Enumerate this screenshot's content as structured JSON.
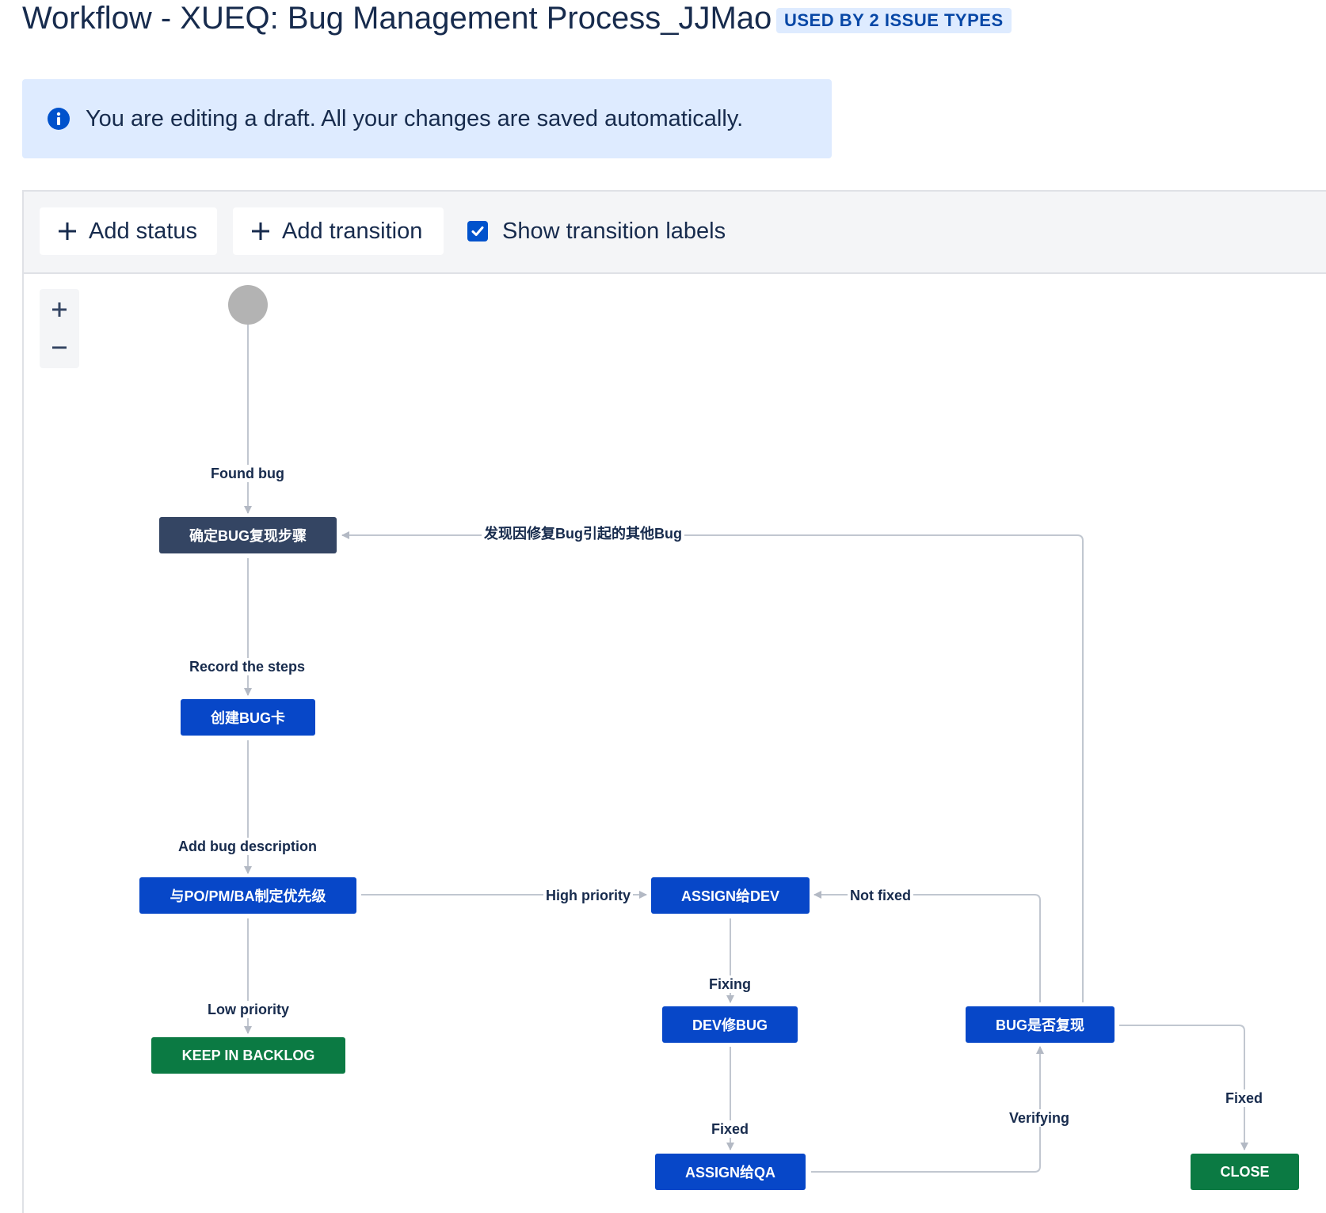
{
  "page": {
    "title": "Workflow - XUEQ: Bug Management Process_JJMao",
    "usage_badge": "USED BY 2 ISSUE TYPES"
  },
  "banner": {
    "icon": "info-icon",
    "message": "You are editing a draft. All your changes are saved automatically."
  },
  "toolbar": {
    "add_status_label": "Add status",
    "add_transition_label": "Add transition",
    "show_labels_label": "Show transition labels",
    "show_labels_checked": true
  },
  "zoom": {
    "in_label": "+",
    "out_label": "−"
  },
  "colors": {
    "accent": "#0052cc",
    "status_in_progress": "#0747c8",
    "status_done": "#0b7a43",
    "status_todo": "#344563",
    "banner_bg": "#deebff"
  },
  "statuses": {
    "confirm_steps": "确定BUG复现步骤",
    "create_card": "创建BUG卡",
    "set_priority": "与PO/PM/BA制定优先级",
    "keep_backlog": "KEEP IN BACKLOG",
    "assign_dev": "ASSIGN给DEV",
    "dev_fix": "DEV修BUG",
    "assign_qa": "ASSIGN给QA",
    "reproducible": "BUG是否复现",
    "close": "CLOSE"
  },
  "transitions": {
    "found_bug": "Found bug",
    "record_steps": "Record the steps",
    "add_description": "Add bug description",
    "low_priority": "Low priority",
    "high_priority": "High priority",
    "fixing": "Fixing",
    "fixed_dev": "Fixed",
    "verifying": "Verifying",
    "not_fixed": "Not fixed",
    "fixed_close": "Fixed",
    "other_bug": "发现因修复Bug引起的其他Bug"
  }
}
